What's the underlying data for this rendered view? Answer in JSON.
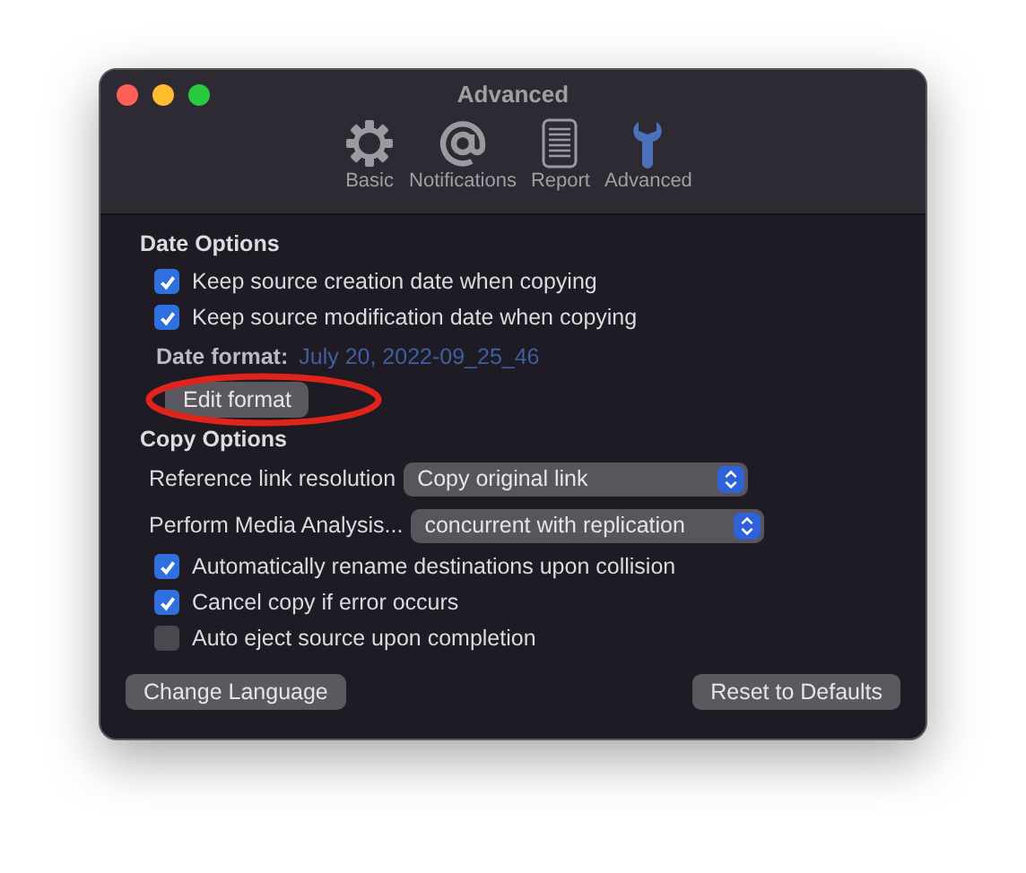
{
  "window": {
    "title": "Advanced"
  },
  "tabs": [
    {
      "label": "Basic",
      "kind": "gear",
      "selected": false
    },
    {
      "label": "Notifications",
      "kind": "at",
      "selected": false
    },
    {
      "label": "Report",
      "kind": "report",
      "selected": false
    },
    {
      "label": "Advanced",
      "kind": "wrench",
      "selected": true
    }
  ],
  "date_options": {
    "heading": "Date Options",
    "checkboxes": [
      {
        "label": "Keep source creation date when copying",
        "checked": true
      },
      {
        "label": "Keep source modification date when copying",
        "checked": true
      }
    ],
    "date_format_label": "Date format:",
    "date_format_value": "July 20, 2022-09_25_46",
    "edit_button": "Edit format"
  },
  "copy_options": {
    "heading": "Copy Options",
    "selects": [
      {
        "label": "Reference link resolution",
        "value": "Copy original link"
      },
      {
        "label": "Perform Media Analysis...",
        "value": "concurrent with replication"
      }
    ],
    "checkboxes": [
      {
        "label": "Automatically rename destinations upon collision",
        "checked": true
      },
      {
        "label": "Cancel copy if error occurs",
        "checked": true
      },
      {
        "label": "Auto eject source upon completion",
        "checked": false
      }
    ]
  },
  "buttons": [
    "Change Language",
    "Reset to Defaults"
  ]
}
